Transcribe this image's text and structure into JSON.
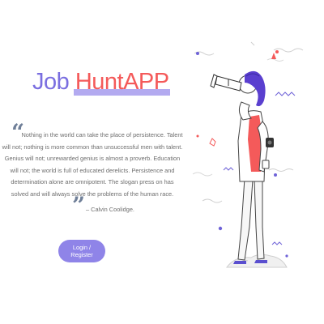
{
  "brand": {
    "part1": "Job",
    "part2": "HuntAPP",
    "colors": {
      "job": "#7a6ee0",
      "hunt": "#f45a5a",
      "highlight": "#b3aaf0"
    }
  },
  "quote": {
    "open_mark": "“",
    "close_mark": "”",
    "text": "Nothing in the world can take the place of persistence. Talent will not; nothing is more common than unsuccessful men with talent. Genius will not; unrewarded genius is almost a proverb. Education will not; the world is full of educated derelicts. Persistence and determination alone are omnipotent. The slogan press on has solved and will always solve the problems of the human race.",
    "author": "– Calvin Coolidge."
  },
  "cta": {
    "login_label": "Login / Register",
    "color": "#8f84e8"
  },
  "illustration": {
    "icon": "woman-with-telescope-illustration"
  }
}
